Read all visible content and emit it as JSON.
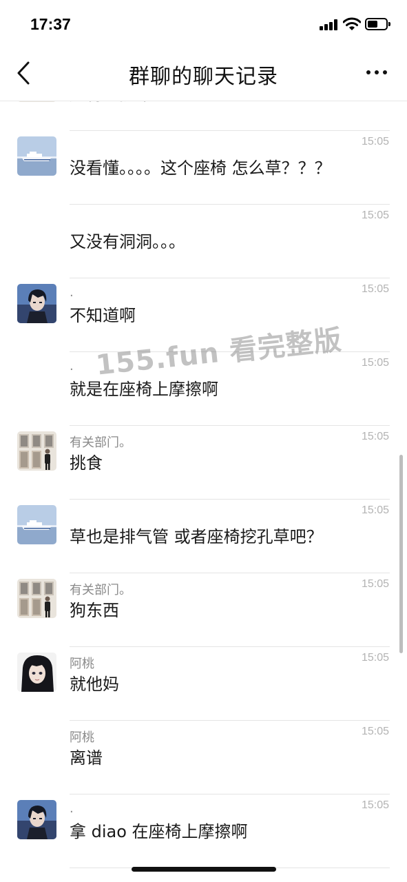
{
  "status_bar": {
    "time": "17:37",
    "signal_icon": "cellular-signal-icon",
    "wifi_icon": "wifi-icon",
    "battery_icon": "battery-icon",
    "battery_level": 0.55
  },
  "nav": {
    "back_icon": "chevron-left-icon",
    "title": "群聊的聊天记录",
    "more_icon": "more-horizontal-icon"
  },
  "watermark": "155.fun 看完整版",
  "messages": [
    {
      "sender": "",
      "time": "",
      "text": "还特么挑车",
      "avatar": "building-man"
    },
    {
      "sender": "",
      "time": "15:05",
      "text": "没看懂。。。。这个座椅 怎么草？？？",
      "avatar": "boat"
    },
    {
      "sender": "",
      "time": "15:05",
      "text": "又没有洞洞。。。",
      "avatar": ""
    },
    {
      "sender": ".",
      "time": "15:05",
      "text": "不知道啊",
      "avatar": "anime-boy"
    },
    {
      "sender": ".",
      "time": "15:05",
      "text": "就是在座椅上摩擦啊",
      "avatar": ""
    },
    {
      "sender": "有关部门。",
      "time": "15:05",
      "text": "挑食",
      "avatar": "building-man"
    },
    {
      "sender": "",
      "time": "15:05",
      "text": "草也是排气管 或者座椅挖孔草吧？",
      "avatar": "boat"
    },
    {
      "sender": "有关部门。",
      "time": "15:05",
      "text": "狗东西",
      "avatar": "building-man"
    },
    {
      "sender": "阿桃",
      "time": "15:05",
      "text": "就他妈",
      "avatar": "anime-girl"
    },
    {
      "sender": "阿桃",
      "time": "15:05",
      "text": "离谱",
      "avatar": ""
    },
    {
      "sender": ".",
      "time": "15:05",
      "text": "拿 diao 在座椅上摩擦啊",
      "avatar": "anime-boy"
    }
  ]
}
